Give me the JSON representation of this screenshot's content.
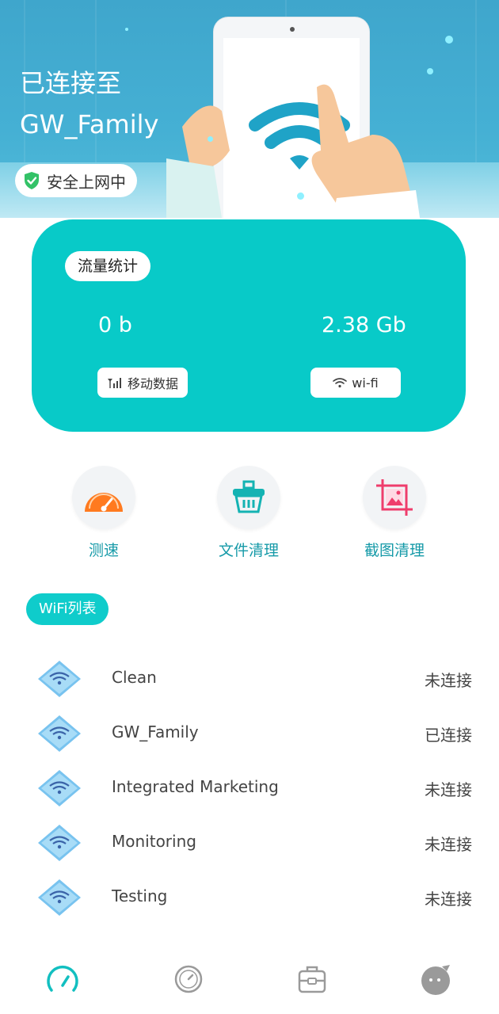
{
  "banner": {
    "title_line1": "已连接至",
    "title_line2": "GW_Family",
    "safety_badge": "安全上网中"
  },
  "traffic_card": {
    "tag": "流量统计",
    "mobile_value": "0 b",
    "wifi_value": "2.38 Gb",
    "mobile_label": "移动数据",
    "wifi_label": "wi-fi",
    "accent_color": "#08cac8"
  },
  "tools": [
    {
      "label": "测速",
      "icon": "speedometer-icon"
    },
    {
      "label": "文件清理",
      "icon": "basket-clean-icon"
    },
    {
      "label": "截图清理",
      "icon": "screenshot-crop-icon"
    }
  ],
  "wifi_list": {
    "tag": "WiFi列表",
    "items": [
      {
        "name": "Clean",
        "status": "未连接"
      },
      {
        "name": "GW_Family",
        "status": "已连接"
      },
      {
        "name": "Integrated Marketing",
        "status": "未连接"
      },
      {
        "name": "Monitoring",
        "status": "未连接"
      },
      {
        "name": "Testing",
        "status": "未连接"
      }
    ]
  },
  "bottom_nav": [
    {
      "icon": "speed-nav-icon",
      "active": true
    },
    {
      "icon": "timer-nav-icon",
      "active": false
    },
    {
      "icon": "toolbox-nav-icon",
      "active": false
    },
    {
      "icon": "profile-nav-icon",
      "active": false
    }
  ]
}
